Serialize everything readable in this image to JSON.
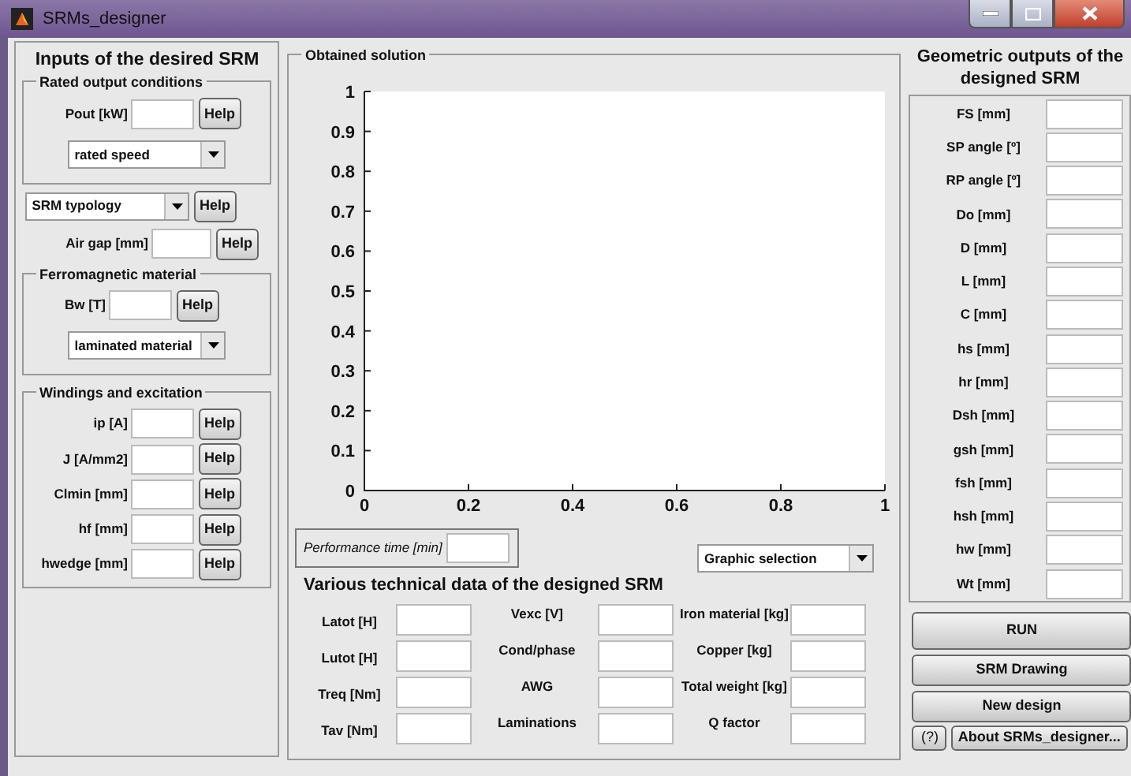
{
  "window": {
    "title": "SRMs_designer"
  },
  "inputs": {
    "title": "Inputs of the desired SRM",
    "rated_output": {
      "title": "Rated output conditions",
      "fields": [
        {
          "label": "Pout [kW]",
          "button": "Help"
        }
      ],
      "dropdown": "rated speed"
    },
    "typology": {
      "dropdown": "SRM typology",
      "button": "Help"
    },
    "air_gap": {
      "label": "Air gap [mm]",
      "button": "Help"
    },
    "ferromagnetic": {
      "title": "Ferromagnetic material",
      "fields": [
        {
          "label": "Bw [T]",
          "button": "Help"
        }
      ],
      "dropdown": "laminated material"
    },
    "windings": {
      "title": "Windings and excitation",
      "fields": [
        {
          "label": "ip [A]",
          "button": "Help"
        },
        {
          "label": "J [A/mm2]",
          "button": "Help"
        },
        {
          "label": "Clmin [mm]",
          "button": "Help"
        },
        {
          "label": "hf [mm]",
          "button": "Help"
        },
        {
          "label": "hwedge [mm]",
          "button": "Help"
        }
      ]
    }
  },
  "solution": {
    "title": "Obtained solution",
    "chart_data": {
      "type": "line",
      "xlim": [
        0,
        1
      ],
      "ylim": [
        0,
        1
      ],
      "xticks": [
        0,
        0.2,
        0.4,
        0.6,
        0.8,
        1
      ],
      "yticks": [
        0,
        0.1,
        0.2,
        0.3,
        0.4,
        0.5,
        0.6,
        0.7,
        0.8,
        0.9,
        1
      ]
    },
    "performance_time": {
      "label": "Performance time [min]"
    },
    "graphic_dropdown": "Graphic selection",
    "technical": {
      "title": "Various technical data of the designed SRM",
      "fields": [
        {
          "label": "Latot [H]"
        },
        {
          "label": "Vexc [V]"
        },
        {
          "label": "Iron material [kg]"
        },
        {
          "label": "Lutot [H]"
        },
        {
          "label": "Cond/phase"
        },
        {
          "label": "Copper [kg]"
        },
        {
          "label": "Treq [Nm]"
        },
        {
          "label": "AWG"
        },
        {
          "label": "Total weight [kg]"
        },
        {
          "label": "Tav [Nm]"
        },
        {
          "label": "Laminations"
        },
        {
          "label": "Q factor"
        }
      ]
    }
  },
  "geometric": {
    "title": "Geometric outputs of the designed SRM",
    "fields": [
      {
        "label": "FS [mm]"
      },
      {
        "label": "SP angle [º]"
      },
      {
        "label": "RP angle [º]"
      },
      {
        "label": "Do [mm]"
      },
      {
        "label": "D [mm]"
      },
      {
        "label": "L [mm]"
      },
      {
        "label": "C [mm]"
      },
      {
        "label": "hs [mm]"
      },
      {
        "label": "hr [mm]"
      },
      {
        "label": "Dsh [mm]"
      },
      {
        "label": "gsh [mm]"
      },
      {
        "label": "fsh [mm]"
      },
      {
        "label": "hsh [mm]"
      },
      {
        "label": "hw [mm]"
      },
      {
        "label": "Wt [mm]"
      }
    ]
  },
  "buttons": [
    {
      "label": "RUN"
    },
    {
      "label": "SRM Drawing"
    },
    {
      "label": "New design"
    }
  ],
  "help_button": "(?)",
  "about_button": "About SRMs_designer..."
}
